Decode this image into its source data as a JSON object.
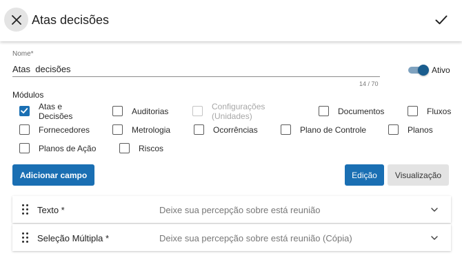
{
  "header": {
    "title": "Atas decisões",
    "close_icon": "close-icon",
    "confirm_icon": "check-icon"
  },
  "form": {
    "name_label": "Nome*",
    "name_value": "Atas  decisões",
    "name_counter": "14 / 70",
    "active_label": "Ativo",
    "active_on": true
  },
  "modules": {
    "title": "Módulos",
    "items": [
      {
        "label": "Atas e\nDecisões",
        "checked": true,
        "disabled": false
      },
      {
        "label": "Auditorias",
        "checked": false,
        "disabled": false
      },
      {
        "label": "Configurações\n(Unidades)",
        "checked": false,
        "disabled": true
      },
      {
        "label": "Documentos",
        "checked": false,
        "disabled": false
      },
      {
        "label": "Fluxos",
        "checked": false,
        "disabled": false
      },
      {
        "label": "Fornecedores",
        "checked": false,
        "disabled": false
      },
      {
        "label": "Metrologia",
        "checked": false,
        "disabled": false
      },
      {
        "label": "Ocorrências",
        "checked": false,
        "disabled": false
      },
      {
        "label": "Plano de Controle",
        "checked": false,
        "disabled": false
      },
      {
        "label": "Planos",
        "checked": false,
        "disabled": false
      },
      {
        "label": "Planos de Ação",
        "checked": false,
        "disabled": false
      },
      {
        "label": "Riscos",
        "checked": false,
        "disabled": false
      }
    ]
  },
  "actions": {
    "add_field": "Adicionar campo",
    "edit": "Edição",
    "preview": "Visualização"
  },
  "fields": [
    {
      "name": "Texto *",
      "description": "Deixe sua percepção sobre está reunião"
    },
    {
      "name": "Seleção Múltipla *",
      "description": "Deixe sua percepção sobre está reunião (Cópia)"
    }
  ],
  "colors": {
    "primary": "#1a6fb3",
    "toggle_thumb": "#1a5d8e",
    "secondary_bg": "#e3e3e3"
  }
}
